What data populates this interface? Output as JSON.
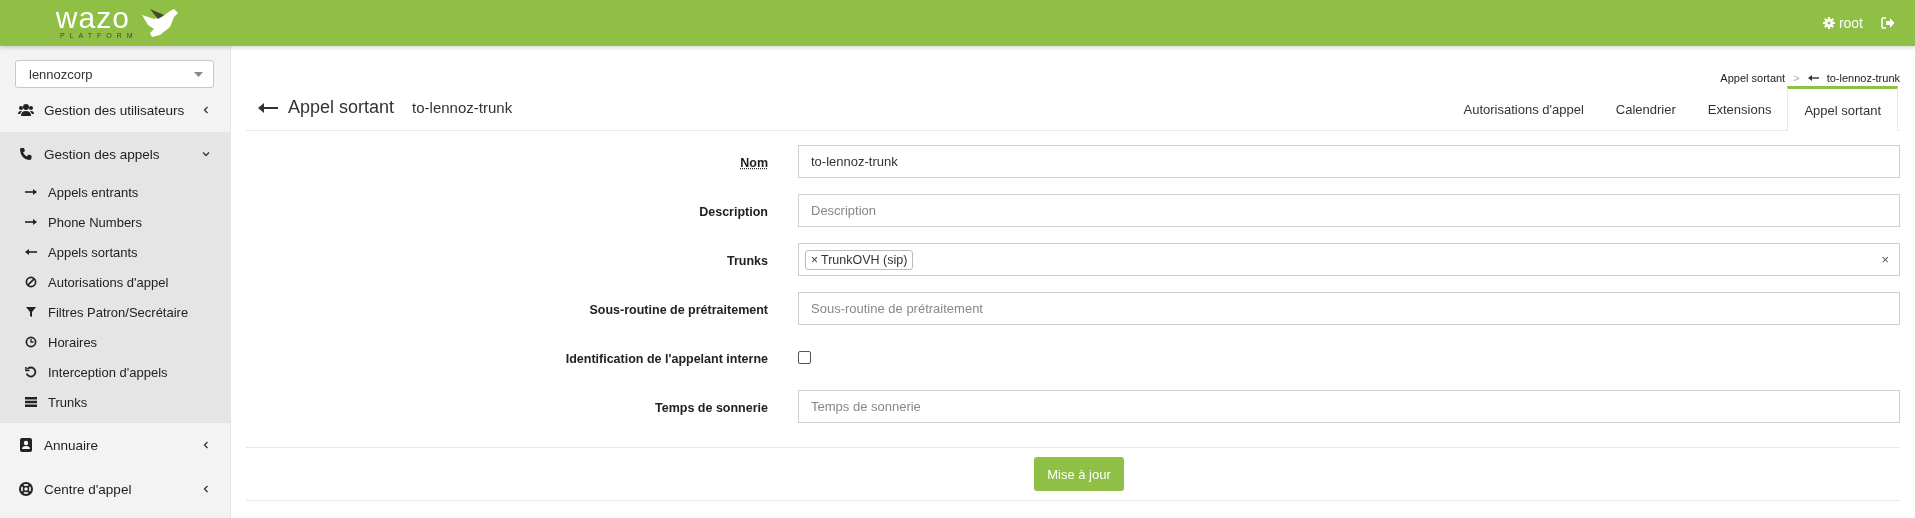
{
  "header": {
    "logo_text": "wazo",
    "logo_subtitle": "PLATFORM",
    "user": "root"
  },
  "sidebar": {
    "tenant_select": "lennozcorp",
    "menu": [
      {
        "label": "Gestion des utilisateurs",
        "kind": "users",
        "expanded": false
      },
      {
        "label": "Gestion des appels",
        "kind": "phone",
        "expanded": true,
        "children": [
          {
            "label": "Appels entrants",
            "kind": "arrow-right"
          },
          {
            "label": "Phone Numbers",
            "kind": "arrow-right"
          },
          {
            "label": "Appels sortants",
            "kind": "arrow-left"
          },
          {
            "label": "Autorisations d'appel",
            "kind": "ban"
          },
          {
            "label": "Filtres Patron/Secrétaire",
            "kind": "filter"
          },
          {
            "label": "Horaires",
            "kind": "clock"
          },
          {
            "label": "Interception d'appels",
            "kind": "undo"
          },
          {
            "label": "Trunks",
            "kind": "server"
          }
        ]
      },
      {
        "label": "Annuaire",
        "kind": "contact",
        "expanded": false
      },
      {
        "label": "Centre d'appel",
        "kind": "lifering",
        "expanded": false
      }
    ]
  },
  "breadcrumb": {
    "items": [
      "Appel sortant",
      "to-lennoz-trunk"
    ],
    "separator": ">"
  },
  "page": {
    "title": "Appel sortant",
    "subtitle": "to-lennoz-trunk"
  },
  "tabs": [
    {
      "label": "Autorisations d'appel",
      "selected": false
    },
    {
      "label": "Calendrier",
      "selected": false
    },
    {
      "label": "Extensions",
      "selected": false
    },
    {
      "label": "Appel sortant",
      "selected": true
    }
  ],
  "form": {
    "fields": [
      {
        "kind": "text",
        "label": "Nom",
        "required": true,
        "value": "to-lennoz-trunk"
      },
      {
        "kind": "text",
        "label": "Description",
        "required": false,
        "placeholder": "Description"
      },
      {
        "kind": "tags",
        "label": "Trunks",
        "required": false,
        "tags": [
          "TrunkOVH (sip)"
        ],
        "tag_remove": "×",
        "clear": "×"
      },
      {
        "kind": "text",
        "label": "Sous-routine de prétraitement",
        "required": false,
        "placeholder": "Sous-routine de prétraitement"
      },
      {
        "kind": "checkbox",
        "label": "Identification de l'appelant interne",
        "required": false,
        "checked": false
      },
      {
        "kind": "text",
        "label": "Temps de sonnerie",
        "required": false,
        "placeholder": "Temps de sonnerie"
      }
    ],
    "submit": "Mise à jour"
  }
}
